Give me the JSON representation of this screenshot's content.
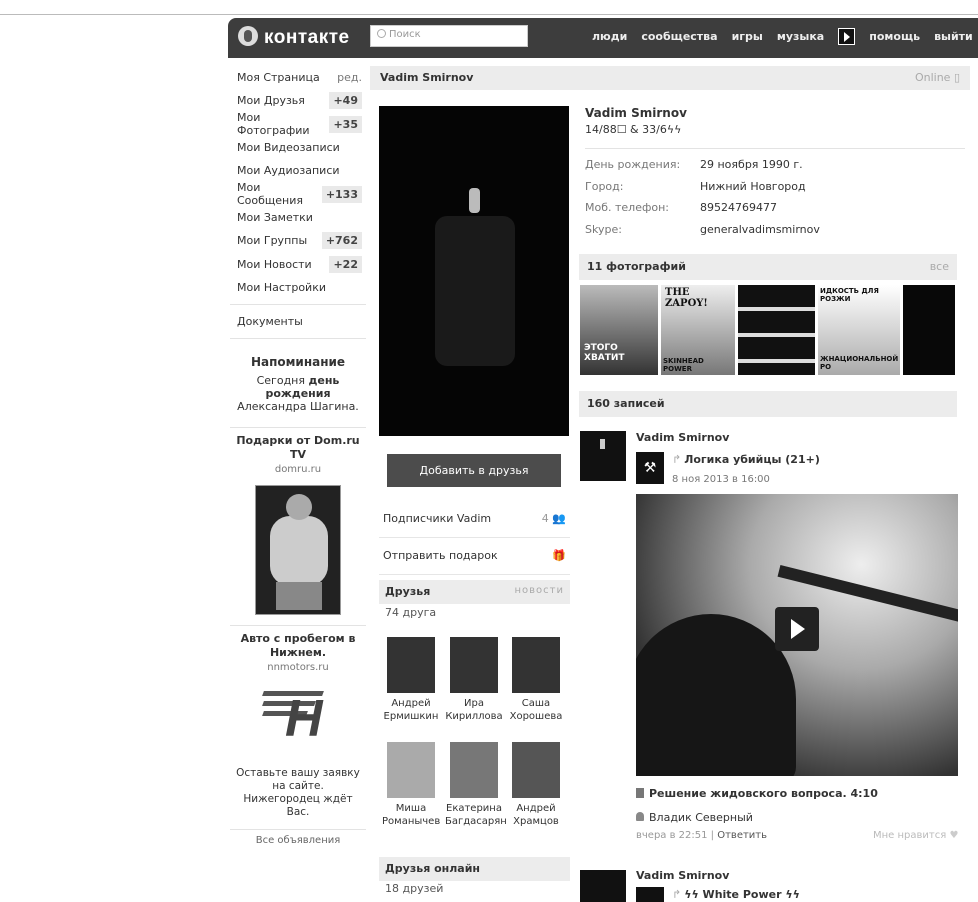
{
  "header": {
    "logo": "контакте",
    "search_placeholder": "Поиск",
    "nav": [
      "люди",
      "сообщества",
      "игры",
      "музыка",
      "помощь",
      "выйти"
    ]
  },
  "sidebar": {
    "items": [
      {
        "label": "Моя Страница",
        "extra": "ред."
      },
      {
        "label": "Мои Друзья",
        "count": "+49"
      },
      {
        "label": "Мои Фотографии",
        "count": "+35"
      },
      {
        "label": "Мои Видеозаписи"
      },
      {
        "label": "Мои Аудиозаписи"
      },
      {
        "label": "Мои Сообщения",
        "count": "+133"
      },
      {
        "label": "Мои Заметки"
      },
      {
        "label": "Мои Группы",
        "count": "+762"
      },
      {
        "label": "Мои Новости",
        "count": "+22"
      },
      {
        "label": "Мои Настройки"
      }
    ],
    "documents": "Документы",
    "reminder": {
      "title": "Напоминание",
      "text_1": "Сегодня",
      "text_bold": "день рождения",
      "text_2": "Александра Шагина."
    },
    "ad1": {
      "title": "Подарки от Dom.ru TV",
      "domain": "domru.ru"
    },
    "ad2": {
      "title": "Авто с пробегом в Нижнем.",
      "domain": "nnmotors.ru",
      "text": "Оставьте вашу заявку на сайте. Нижегородец ждёт Вас."
    },
    "all_ads": "Все объявления"
  },
  "profile": {
    "bar_name": "Vadim Smirnov",
    "online": "Online",
    "name": "Vadim Smirnov",
    "status": "14/88☐ & 33/6ϟϟ",
    "add_friend": "Добавить в друзья",
    "subscribers": {
      "label": "Подписчики Vadim",
      "count": "4"
    },
    "gift": "Отправить подарок",
    "info": [
      {
        "label": "День рождения:",
        "value": "29 ноября 1990 г."
      },
      {
        "label": "Город:",
        "value": "Нижний Новгород"
      },
      {
        "label": "Моб. телефон:",
        "value": "89524769477"
      },
      {
        "label": "Skype:",
        "value": "generalvadimsmirnov"
      }
    ]
  },
  "friends": {
    "title": "Друзья",
    "news": "новости",
    "count": "74 друга",
    "list": [
      {
        "first": "Андрей",
        "last": "Ермишкин"
      },
      {
        "first": "Ира",
        "last": "Кириллова"
      },
      {
        "first": "Саша",
        "last": "Хорошева"
      },
      {
        "first": "Миша",
        "last": "Романычев"
      },
      {
        "first": "Екатерина",
        "last": "Багдасарян"
      },
      {
        "first": "Андрей",
        "last": "Храмцов"
      }
    ],
    "online_title": "Друзья онлайн",
    "online_count": "18 друзей"
  },
  "photos": {
    "title": "11 фотографий",
    "all": "все",
    "captions": [
      "ЭТОГО ХВАТИТ",
      "THE ZAPOY!",
      "",
      "ИДКОСТЬ ДЛЯ РОЗЖИ",
      ""
    ],
    "captions2": [
      "",
      "SKINHEAD POWER",
      "",
      "ЖНАЦИОНАЛЬНОЙ РО",
      ""
    ]
  },
  "wall": {
    "title": "160 записей",
    "post1": {
      "author": "Vadim Smirnov",
      "repost_title": "Логика убийцы (21+)",
      "repost_date": "8 ноя 2013 в 16:00",
      "video_title": "Решение жидовского вопроса. 4:10",
      "comment_author": "Владик Северный",
      "comment_time": "вчера в 22:51",
      "reply": "Ответить",
      "like": "Мне нравится"
    },
    "post2": {
      "author": "Vadim Smirnov",
      "repost_title": "ϟϟ White Power ϟϟ"
    }
  }
}
